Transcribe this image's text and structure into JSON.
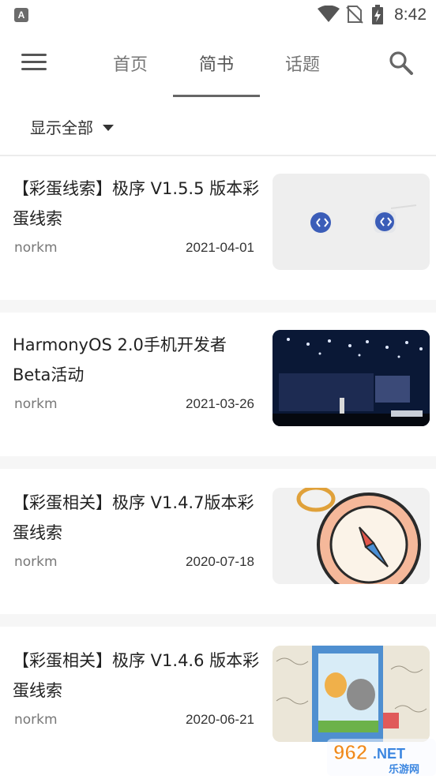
{
  "status_bar": {
    "time": "8:42",
    "app_icon_letter": "A"
  },
  "nav": {
    "tabs": [
      {
        "label": "首页",
        "active": false
      },
      {
        "label": "简书",
        "active": true
      },
      {
        "label": "话题",
        "active": false
      }
    ]
  },
  "filter": {
    "label": "显示全部"
  },
  "articles": [
    {
      "title": "【彩蛋线索】极序 V1.5.5 版本彩蛋线索",
      "author": "norkm",
      "date": "2021-04-01"
    },
    {
      "title": "HarmonyOS 2.0手机开发者Beta活动",
      "author": "norkm",
      "date": "2021-03-26"
    },
    {
      "title": "【彩蛋相关】极序 V1.4.7版本彩蛋线索",
      "author": "norkm",
      "date": "2020-07-18"
    },
    {
      "title": "【彩蛋相关】极序 V1.4.6 版本彩蛋线索",
      "author": "norkm",
      "date": "2020-06-21"
    }
  ],
  "watermark": {
    "text": "962.NET",
    "subtext": "乐游网"
  },
  "colors": {
    "accent_underline": "#666666",
    "background": "#ffffff",
    "separator": "#f6f6f6"
  }
}
